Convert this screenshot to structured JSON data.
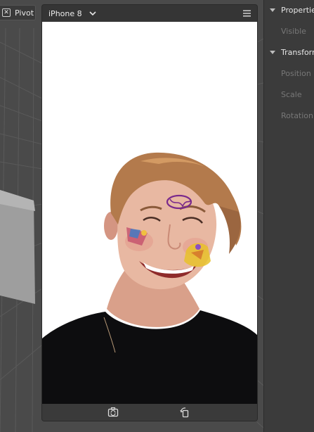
{
  "viewport": {
    "pivot_label": "Pivot"
  },
  "simulator": {
    "device_name": "iPhone 8"
  },
  "properties_panel": {
    "properties_header": "Properties",
    "visible_label": "Visible",
    "transform_header": "Transform",
    "position_label": "Position",
    "scale_label": "Scale",
    "rotation_label": "Rotation"
  },
  "colors": {
    "viewport_bg": "#4a4a4a",
    "panel_bg": "#3b3b3b",
    "sticker_purple": "#7a2a8c",
    "sticker_yellow": "#e8c12a"
  }
}
